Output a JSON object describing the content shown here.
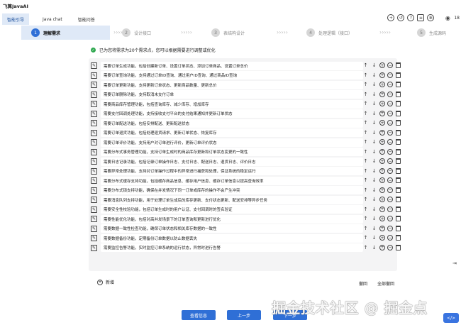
{
  "app": {
    "title": "飞算JavaAI"
  },
  "nav": {
    "tabs": [
      {
        "label": "智能引导",
        "active": true
      },
      {
        "label": "Java chat",
        "active": false
      },
      {
        "label": "智能问答",
        "active": false
      }
    ],
    "icons": [
      "plus-icon",
      "history-icon",
      "help-icon",
      "database-icon",
      "settings-icon",
      "user-icon"
    ],
    "count": "18"
  },
  "steps": [
    {
      "num": "1",
      "label": "理解需求",
      "active": true
    },
    {
      "num": "2",
      "label": "设计接口",
      "active": false
    },
    {
      "num": "3",
      "label": "表结构设计",
      "active": false
    },
    {
      "num": "4",
      "label": "处理逻辑（接口）",
      "active": false
    },
    {
      "num": "5",
      "label": "生成源码",
      "active": false
    }
  ],
  "notice": "已为您将需求为20个需求点，您可以根据需要进行调整或优化",
  "requirements": [
    "需要订单生成功能，包括创建新订单、设置订单状态、添加订单商品、设置订单总价",
    "需要订单查询功能，支持通过订单ID查询、通过用户ID查询、通过商品ID查询",
    "需要订单更新功能，支持更新订单状态、更新商品数量、更新总价",
    "需要订单删除功能，支持取消未支付订单",
    "需要商品库存管理功能，包括查询库存、减少库存、增加库存",
    "需要支付回调处理功能，支持接收支付平台的支付结果通知并更新订单状态",
    "需要订单配送功能，包括安排配送、更新配送状态",
    "需要订单退货功能，包括处理退货请求、更新订单状态、恢复库存",
    "需要订单评价功能，支持用户对订单进行评价，更新订单评价状态",
    "需要分布式事务管理功能，支持订单生成时的商品库存更新和订单状态变更的一致性",
    "需要日志记录功能，包括记录订单操作日志、支付日志、配送日志、退货日志、评价日志",
    "需要异常处理功能，支持对订单操作过程中的异常进行捕获和处理，保证系统的稳定运行",
    "需要分布式缓存支持功能，包括缓存商品信息、缓存用户信息、缓存订单信息以提高查询效率",
    "需要分布式锁支持功能，确保在并发情况下同一订单或库存的操作不会产生冲突",
    "需要消息队列支持功能，用于处理订单生成后的库存更新、支付状态更新、配送安排等异步任务",
    "需要安全性校验功能，包括订单生成时的用户认证、支付回调时的签名验证",
    "需要性能优化功能，包括对高并发场景下的订单查询和更新进行优化",
    "需要数据一致性检查功能，确保订单状态和相关库存数据的一致性",
    "需要数据备份功能，定期备份订单数据以防止数据丢失",
    "需要监控告警功能，实时监控订单系统的运行状态，异常时进行告警"
  ],
  "row_actions": [
    "up-arrow-icon",
    "down-arrow-icon",
    "add-circle-icon",
    "remove-circle-icon",
    "trash-icon"
  ],
  "panel_footer": {
    "undo": "撤回",
    "undo_all": "全部撤回"
  },
  "add": {
    "label": "新增"
  },
  "buttons": {
    "view_info": "查看信息",
    "prev": "上一步",
    "next": "下一步"
  },
  "watermark": "掘金技术社区 @ 掘金点",
  "badge": "</>",
  "colors": {
    "accent": "#2f6fd6",
    "active_bg": "#dfe9f7",
    "check": "#2fa84f"
  }
}
